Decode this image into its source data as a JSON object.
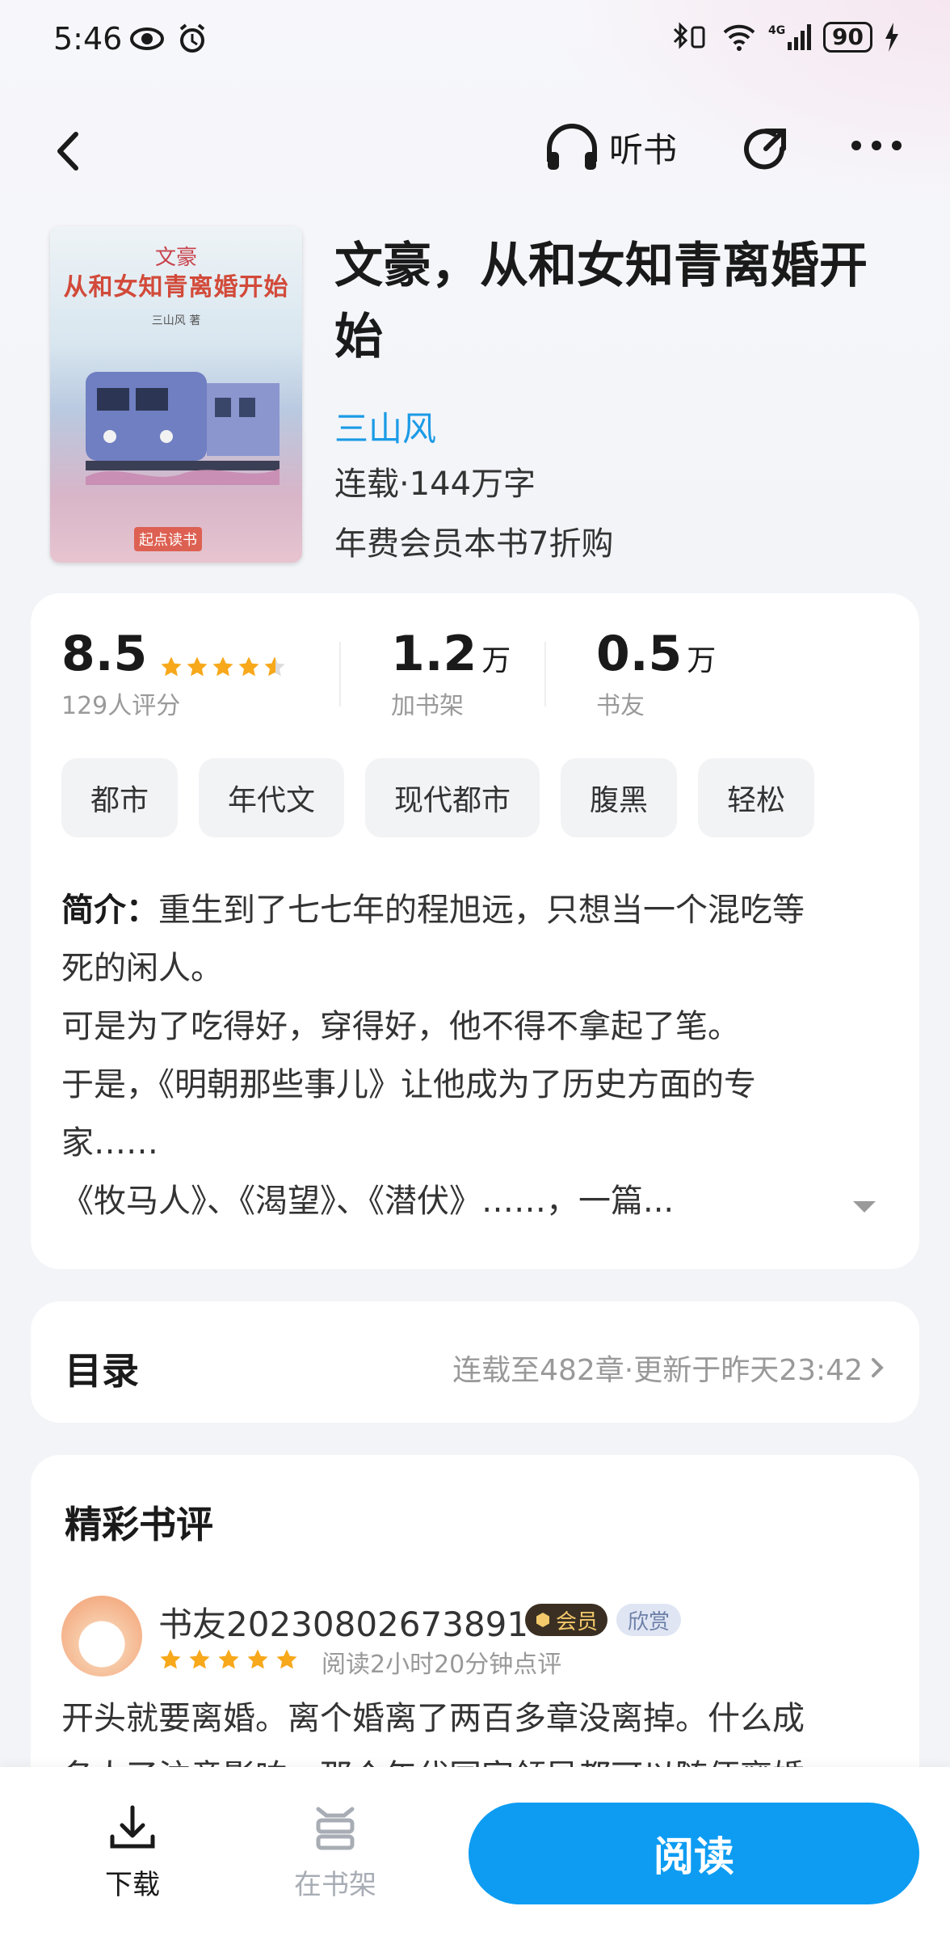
{
  "status": {
    "time": "5:46",
    "battery": "90"
  },
  "nav": {
    "listen_label": "听书"
  },
  "book": {
    "cover_title_small": "文豪",
    "cover_title": "从和女知青离婚开始",
    "cover_author": "三山风 著",
    "cover_publisher": "起点读书",
    "title": "文豪，从和女知青离婚开始",
    "author": "三山风",
    "meta": "连载·144万字",
    "vip_offer": "年费会员本书7折购"
  },
  "stats": {
    "rating": "8.5",
    "rating_stars": 4.5,
    "rating_count": "129人评分",
    "shelf_num": "1.2",
    "shelf_unit": "万",
    "shelf_label": "加书架",
    "fans_num": "0.5",
    "fans_unit": "万",
    "fans_label": "书友"
  },
  "tags": [
    "都市",
    "年代文",
    "现代都市",
    "腹黑",
    "轻松"
  ],
  "intro": {
    "label": "简介：",
    "line1": "重生到了七七年的程旭远，只想当一个混吃等",
    "line2": "死的闲人。",
    "line3": "可是为了吃得好，穿得好，他不得不拿起了笔。",
    "line4": "于是，《明朝那些事儿》让他成为了历史方面的专",
    "line5": "家……",
    "line6": "《牧马人》、《渴望》、《潜伏》……，一篇..."
  },
  "toc": {
    "label": "目录",
    "info": "连载至482章·更新于昨天23:42"
  },
  "reviews": {
    "heading": "精彩书评",
    "items": [
      {
        "user": "书友20230802673891",
        "badge_member": "会员",
        "badge_appreciate": "欣赏",
        "stars": 5,
        "meta": "阅读2小时20分钟点评",
        "line1": "开头就要离婚。离个婚离了两百多章没离掉。什么成",
        "line2": "名人了注意影响，那个年代国家领导都可以随便离婚"
      }
    ]
  },
  "bottom": {
    "download_label": "下载",
    "shelf_label": "在书架",
    "read_label": "阅读"
  },
  "colors": {
    "accent": "#0d9cf2",
    "author_link": "#1b9be6",
    "star": "#f7a81b"
  }
}
